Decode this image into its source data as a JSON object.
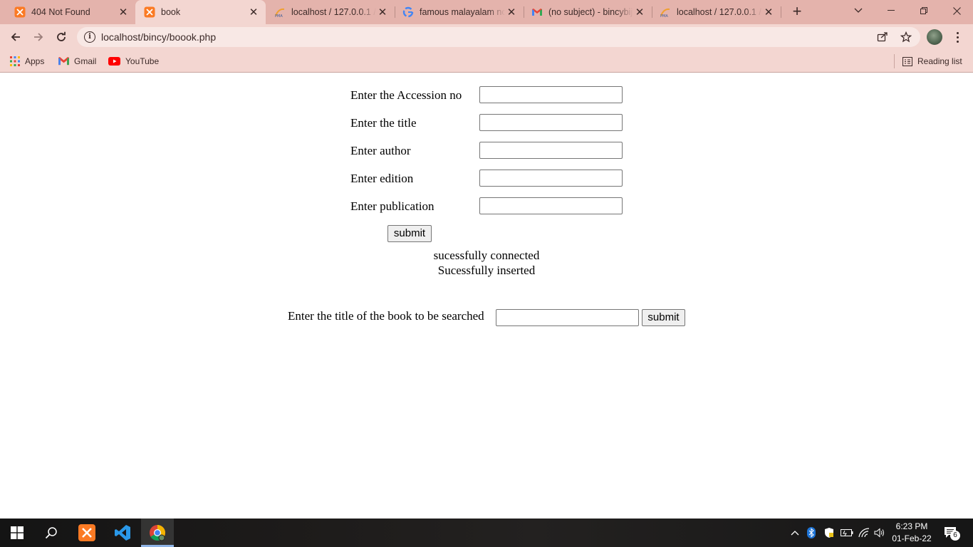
{
  "browser": {
    "tabs": [
      {
        "title": "404 Not Found",
        "icon": "xampp-icon"
      },
      {
        "title": "book",
        "icon": "xampp-icon",
        "active": true
      },
      {
        "title": "localhost / 127.0.0.1 /",
        "icon": "phpmyadmin-icon"
      },
      {
        "title": "famous malayalam no",
        "icon": "google-icon"
      },
      {
        "title": "(no subject) - bincybij",
        "icon": "gmail-icon"
      },
      {
        "title": "localhost / 127.0.0.1 /",
        "icon": "phpmyadmin-icon"
      }
    ],
    "address_bar": {
      "url": "localhost/bincy/boook.php"
    },
    "bookmarks": {
      "apps": "Apps",
      "gmail": "Gmail",
      "youtube": "YouTube",
      "reading_list": "Reading list"
    }
  },
  "form": {
    "accession_label": "Enter the Accession no",
    "title_label": "Enter the title",
    "author_label": "Enter author",
    "edition_label": "Enter edition",
    "publication_label": "Enter publication",
    "accession_value": "",
    "title_value": "",
    "author_value": "",
    "edition_value": "",
    "publication_value": "",
    "submit_label": "submit"
  },
  "messages": {
    "connected": "sucessfully connected",
    "inserted": "Sucessfully inserted"
  },
  "search": {
    "label": "Enter the title of the book to be searched",
    "value": "",
    "submit_label": "submit"
  },
  "taskbar": {
    "time": "6:23 PM",
    "date": "01-Feb-22",
    "notification_count": "6"
  },
  "colors": {
    "tab_strip": "#e4b3ac",
    "toolbar": "#f3d6d1",
    "xampp_orange": "#fb7a24",
    "taskbar": "#1d1b1a"
  }
}
